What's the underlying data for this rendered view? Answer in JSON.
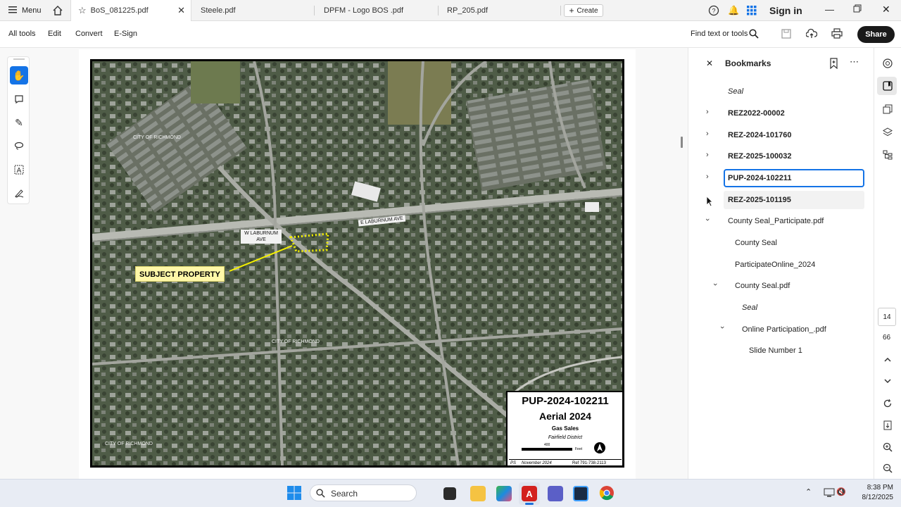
{
  "tabs": {
    "menu_label": "Menu",
    "items": [
      {
        "label": "BoS_081225.pdf"
      },
      {
        "label": "Steele.pdf"
      },
      {
        "label": "DPFM - Logo BOS .pdf"
      },
      {
        "label": "RP_205.pdf"
      }
    ],
    "create_label": "Create",
    "sign_in_label": "Sign in"
  },
  "toolbar": {
    "all_tools": "All tools",
    "edit": "Edit",
    "convert": "Convert",
    "esign": "E-Sign",
    "find_label": "Find text or tools",
    "share_label": "Share"
  },
  "map": {
    "subject_label": "SUBJECT PROPERTY",
    "street_w_laburnum": "W LABURNUM AVE",
    "street_e_laburnum": "E LABURNUM AVE",
    "city_label_1": "CITY OF RICHMOND",
    "city_label_2": "CITY OF RICHMOND",
    "city_label_3": "CITY OF RICHMOND",
    "legend": {
      "case_number": "PUP-2024-102211",
      "title": "Aerial 2024",
      "subtitle": "Gas Sales",
      "district": "Fairfield District",
      "scale_value": "400",
      "scale_unit": "Feet",
      "date": "November 2024",
      "ref": "Ref 791-738-2113",
      "prefix": "PS"
    }
  },
  "bookmarks": {
    "title": "Bookmarks",
    "items": [
      {
        "label": "Seal"
      },
      {
        "label": "REZ2022-00002"
      },
      {
        "label": "REZ-2024-101760"
      },
      {
        "label": "REZ-2025-100032"
      },
      {
        "label": "PUP-2024-102211"
      },
      {
        "label": "REZ-2025-101195"
      },
      {
        "label": "County Seal_Participate.pdf"
      },
      {
        "label": "County Seal"
      },
      {
        "label": "ParticipateOnline_2024"
      },
      {
        "label": "County Seal.pdf"
      },
      {
        "label": "Seal"
      },
      {
        "label": "Online Participation_.pdf"
      },
      {
        "label": "Slide Number 1"
      }
    ]
  },
  "page_nav": {
    "current_page": "14",
    "total_pages": "66"
  },
  "taskbar": {
    "search_label": "Search",
    "time": "8:38 PM",
    "date": "8/12/2025"
  },
  "colors": {
    "accent": "#1473e6",
    "share_button": "#1a1a1a",
    "selected_bookmark_border": "#1473e6",
    "subject_label_bg": "#fff7a8",
    "parcel_outline": "#f4f000"
  }
}
